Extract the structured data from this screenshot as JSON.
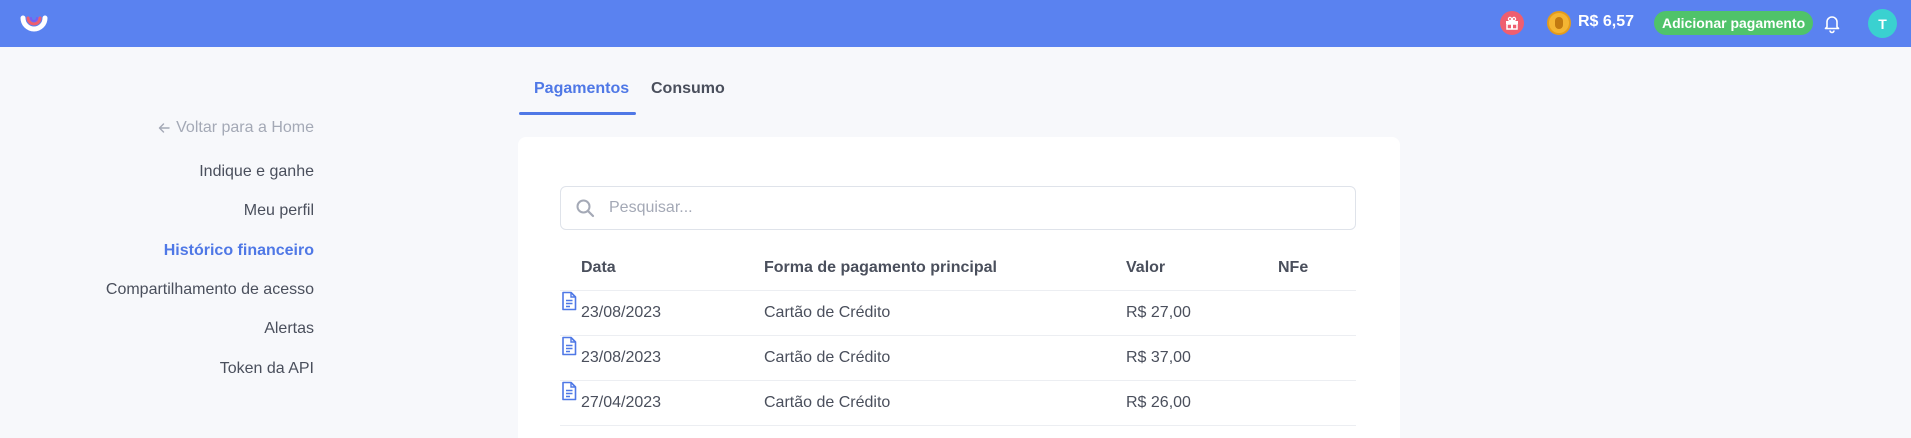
{
  "topbar": {
    "balance": "R$ 6,57",
    "add_payment_label": "Adicionar pagamento",
    "avatar_initial": "T",
    "colors": {
      "bar": "#5a82f0",
      "add_button": "#4fc36a",
      "avatar": "#3ad1d0"
    },
    "icons": [
      "app-logo",
      "gift-icon",
      "coin-icon",
      "bell-icon"
    ]
  },
  "sidebar": {
    "back_label": "Voltar para a Home",
    "items": [
      {
        "label": "Indique e ganhe",
        "active": false
      },
      {
        "label": "Meu perfil",
        "active": false
      },
      {
        "label": "Histórico financeiro",
        "active": true
      },
      {
        "label": "Compartilhamento de acesso",
        "active": false
      },
      {
        "label": "Alertas",
        "active": false
      },
      {
        "label": "Token da API",
        "active": false
      }
    ]
  },
  "tabs": [
    {
      "label": "Pagamentos",
      "active": true
    },
    {
      "label": "Consumo",
      "active": false
    }
  ],
  "search": {
    "placeholder": "Pesquisar...",
    "value": ""
  },
  "table": {
    "headers": [
      "Data",
      "Forma de pagamento principal",
      "Valor",
      "NFe"
    ],
    "rows": [
      {
        "date": "23/08/2023",
        "method": "Cartão de Crédito",
        "value": "R$ 27,00"
      },
      {
        "date": "23/08/2023",
        "method": "Cartão de Crédito",
        "value": "R$ 37,00"
      },
      {
        "date": "27/04/2023",
        "method": "Cartão de Crédito",
        "value": "R$ 26,00"
      }
    ]
  },
  "accent_color": "#4f78e6"
}
